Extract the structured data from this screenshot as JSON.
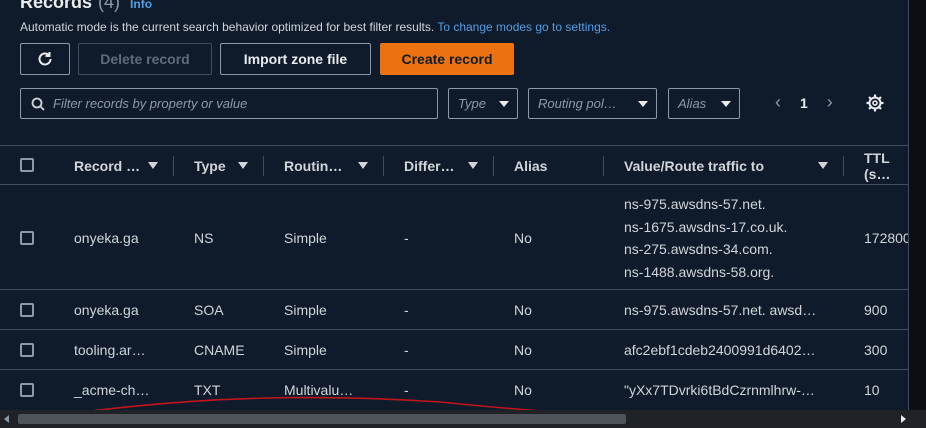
{
  "header": {
    "title": "Records",
    "count": "(4)",
    "info_link": "Info",
    "subtitle": "Automatic mode is the current search behavior optimized for best filter results.",
    "subtitle_link": "To change modes go to settings."
  },
  "toolbar": {
    "refresh_icon": "refresh-icon",
    "delete_label": "Delete record",
    "import_label": "Import zone file",
    "create_label": "Create record"
  },
  "filters": {
    "search_placeholder": "Filter records by property or value",
    "type_label": "Type",
    "routing_label": "Routing pol…",
    "alias_label": "Alias"
  },
  "pagination": {
    "current_page": "1"
  },
  "table": {
    "columns": [
      "Record …",
      "Type",
      "Routin…",
      "Differ…",
      "Alias",
      "Value/Route traffic to",
      "TTL (s…"
    ],
    "rows": [
      {
        "name": "onyeka.ga",
        "type": "NS",
        "routing": "Simple",
        "differ": "-",
        "alias": "No",
        "values": [
          "ns-975.awsdns-57.net.",
          "ns-1675.awsdns-17.co.uk.",
          "ns-275.awsdns-34.com.",
          "ns-1488.awsdns-58.org."
        ],
        "ttl": "172800"
      },
      {
        "name": "onyeka.ga",
        "type": "SOA",
        "routing": "Simple",
        "differ": "-",
        "alias": "No",
        "values": [
          "ns-975.awsdns-57.net. awsd…"
        ],
        "ttl": "900"
      },
      {
        "name": "tooling.ar…",
        "type": "CNAME",
        "routing": "Simple",
        "differ": "-",
        "alias": "No",
        "values": [
          "afc2ebf1cdeb2400991d6402…"
        ],
        "ttl": "300"
      },
      {
        "name": "_acme-ch…",
        "type": "TXT",
        "routing": "Multivalu…",
        "differ": "-",
        "alias": "No",
        "values": [
          "\"yXx7TDvrki6tBdCzrnmlhrw-…"
        ],
        "ttl": "10"
      }
    ]
  },
  "colors": {
    "background": "#0f1b2a",
    "primary": "#ec7211",
    "link": "#539fe5",
    "border": "#414d5c",
    "annotation": "#c0161b"
  }
}
